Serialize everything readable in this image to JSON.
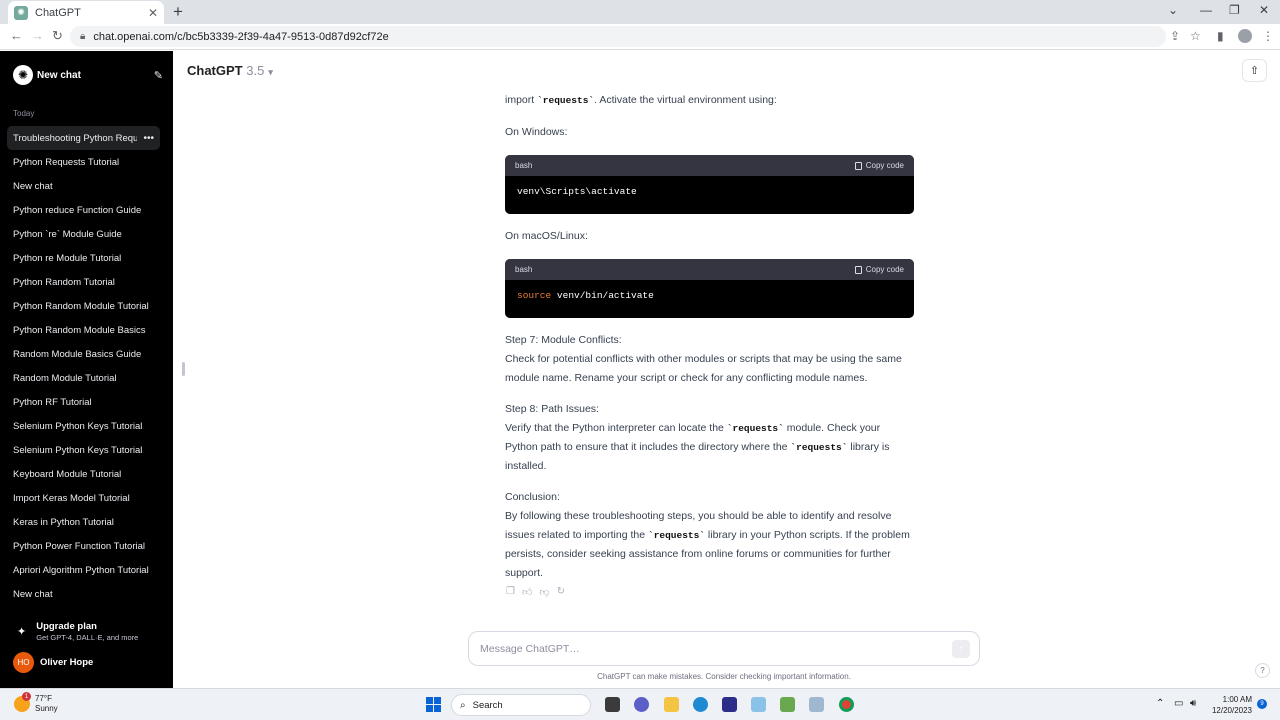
{
  "browser": {
    "tab_title": "ChatGPT",
    "favicon_icon": "chatgpt-logo",
    "tab_close": "✕",
    "new_tab": "+",
    "url": "chat.openai.com/c/bc5b3339-2f39-4a47-9513-0d87d92cf72e"
  },
  "sidebar": {
    "new_chat_label": "New chat",
    "section_label": "Today",
    "items": [
      {
        "label": "Troubleshooting Python Requests",
        "active": true
      },
      {
        "label": "Python Requests Tutorial"
      },
      {
        "label": "New chat"
      },
      {
        "label": "Python reduce Function Guide"
      },
      {
        "label": "Python `re` Module Guide"
      },
      {
        "label": "Python re Module Tutorial"
      },
      {
        "label": "Python Random Tutorial"
      },
      {
        "label": "Python Random Module Tutorial"
      },
      {
        "label": "Python Random Module Basics"
      },
      {
        "label": "Random Module Basics Guide"
      },
      {
        "label": "Random Module Tutorial"
      },
      {
        "label": "Python RF Tutorial"
      },
      {
        "label": "Selenium Python Keys Tutorial"
      },
      {
        "label": "Selenium Python Keys Tutorial"
      },
      {
        "label": "Keyboard Module Tutorial"
      },
      {
        "label": "Import Keras Model Tutorial"
      },
      {
        "label": "Keras in Python Tutorial"
      },
      {
        "label": "Python Power Function Tutorial"
      },
      {
        "label": "Apriori Algorithm Python Tutorial"
      },
      {
        "label": "New chat"
      }
    ],
    "more_glyph": "•••",
    "upgrade_title": "Upgrade plan",
    "upgrade_sub": "Get GPT-4, DALL·E, and more",
    "user_initials": "HO",
    "user_name": "Oliver Hope"
  },
  "header": {
    "model_name": "ChatGPT",
    "model_version": "3.5"
  },
  "message": {
    "p0_pre": "import ",
    "p0_code": "`requests`",
    "p0_post": ". Activate the virtual environment using:",
    "windows_label": "On Windows:",
    "code1": {
      "lang": "bash",
      "copy": "Copy code",
      "line": "venv\\Scripts\\activate"
    },
    "mac_label": "On macOS/Linux:",
    "code2": {
      "lang": "bash",
      "copy": "Copy code",
      "keyword": "source",
      "rest": " venv/bin/activate"
    },
    "step7_title": "Step 7: Module Conflicts:",
    "step7_body": "Check for potential conflicts with other modules or scripts that may be using the same module name. Rename your script or check for any conflicting module names.",
    "step8_title": "Step 8: Path Issues:",
    "step8_a": "Verify that the Python interpreter can locate the ",
    "step8_code1": "`requests`",
    "step8_b": " module. Check your Python path to ensure that it includes the directory where the ",
    "step8_code2": "`requests`",
    "step8_c": " library is installed.",
    "concl_title": "Conclusion:",
    "concl_a": "By following these troubleshooting steps, you should be able to identify and resolve issues related to importing the ",
    "concl_code": "`requests`",
    "concl_b": " library in your Python scripts. If the problem persists, consider seeking assistance from online forums or communities for further support."
  },
  "composer": {
    "placeholder": "Message ChatGPT…",
    "disclaimer": "ChatGPT can make mistakes. Consider checking important information.",
    "help": "?"
  },
  "taskbar": {
    "weather_temp": "77°F",
    "weather_desc": "Sunny",
    "weather_badge": "1",
    "search_label": "Search",
    "time": "1:00 AM",
    "date": "12/20/2023",
    "notif_count": "9"
  },
  "colors": {
    "sidebar_bg": "#000000",
    "code_header": "#343541",
    "code_keyword": "#e87b35",
    "avatar": "#e8590c",
    "start_blue": "#0a64d6"
  }
}
